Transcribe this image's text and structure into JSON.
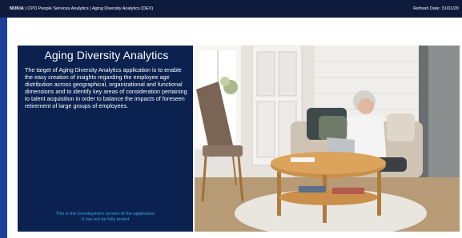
{
  "header": {
    "brand": "NOKIA",
    "breadcrumb": "| CPO People Services Analytics | Aging Diversity Analytics (DEV)",
    "refresh_label": "Refresh Date: 31/01/20"
  },
  "card": {
    "title": "Aging Diversity Analytics",
    "description": "The target of Aging Diversity Analytics application is to enable the easy creation of insights regarding the employee age distribution across geographical, organizational and functional dimensions and to identify key areas of consideration pertaining to talent acquisition in order to balance the impacts of foreseen retirement of large groups of employees.",
    "dev_note_line1": "This is the Development version of the application",
    "dev_note_line2": "It has not be fully tested"
  },
  "colors": {
    "topbar": "#0e1a3b",
    "sidebar_strip": "#1c3f9c",
    "card_bg": "#0b2250",
    "dev_note": "#37a6e6"
  }
}
